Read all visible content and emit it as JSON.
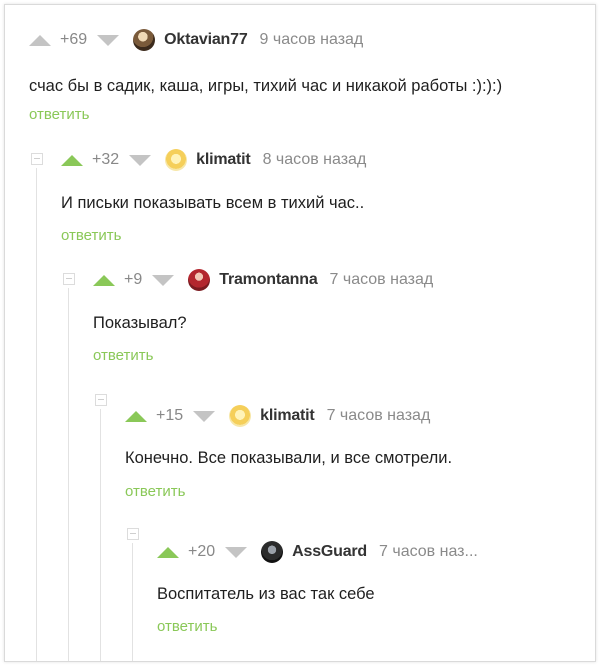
{
  "comments": [
    {
      "rating": "+69",
      "username": "Oktavian77",
      "time": "9 часов назад",
      "text": "счас бы в садик, каша, игры, тихий час и никакой работы :):):)",
      "reply": "ответить",
      "avatar": "avatar-image",
      "upvote_state": "neutral"
    },
    {
      "rating": "+32",
      "username": "klimatit",
      "time": "8 часов назад",
      "text": "И письки показывать всем в тихий час..",
      "reply": "ответить",
      "avatar": "avatar-image",
      "upvote_state": "upvoted"
    },
    {
      "rating": "+9",
      "username": "Tramontanna",
      "time": "7 часов назад",
      "text": "Показывал?",
      "reply": "ответить",
      "avatar": "avatar-image",
      "upvote_state": "upvoted"
    },
    {
      "rating": "+15",
      "username": "klimatit",
      "time": "7 часов назад",
      "text": "Конечно.  Все показывали, и все смотрели.",
      "reply": "ответить",
      "avatar": "avatar-image",
      "upvote_state": "upvoted"
    },
    {
      "rating": "+20",
      "username": "AssGuard",
      "time": "7 часов наз...",
      "text": "Воспитатель из вас так себе",
      "reply": "ответить",
      "avatar": "avatar-image",
      "upvote_state": "upvoted"
    }
  ],
  "colors": {
    "upvote_active": "#8ac858",
    "upvote_inactive": "#c4c4c4",
    "reply_link": "#8ac858",
    "meta_text": "#8a8a8a"
  },
  "icons": [
    "upvote-arrow-icon",
    "downvote-arrow-icon",
    "collapse-icon"
  ]
}
